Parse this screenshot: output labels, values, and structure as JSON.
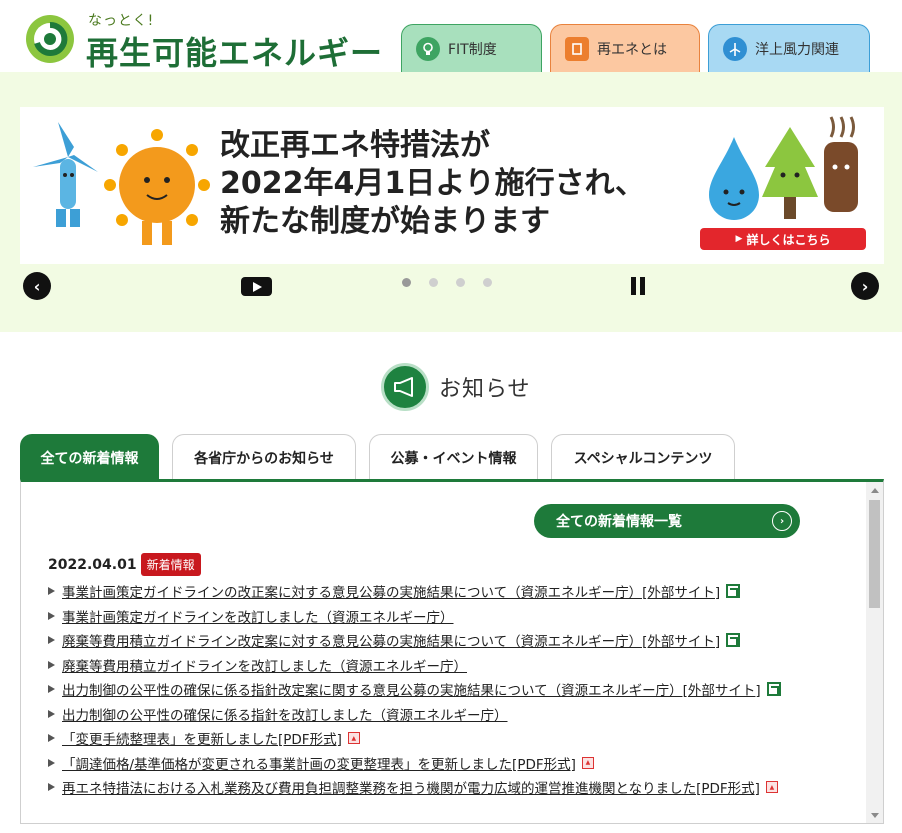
{
  "header": {
    "logo_small": "なっとく!",
    "logo_title": "再生可能エネルギー",
    "nav": [
      {
        "label": "FIT制度",
        "icon": "lightbulb-icon"
      },
      {
        "label": "再エネとは",
        "icon": "document-icon"
      },
      {
        "label": "洋上風力関連",
        "icon": "wind-turbine-icon"
      }
    ]
  },
  "banner": {
    "lines": [
      "改正再エネ特措法が",
      "2022年4月1日より施行され、",
      "新たな制度が始まります"
    ],
    "cta_label": "詳しくはこちら",
    "slide_count": 4,
    "active_slide": 1
  },
  "news": {
    "title": "お知らせ",
    "tabs": [
      "全ての新着情報",
      "各省庁からのお知らせ",
      "公募・イベント情報",
      "スペシャルコンテンツ"
    ],
    "active_tab": 0,
    "all_list_label": "全ての新着情報一覧",
    "date": "2022.04.01",
    "badge": "新着情報",
    "items": [
      {
        "text": "事業計画策定ガイドラインの改正案に対する意見公募の実施結果について（資源エネルギー庁）[外部サイト]",
        "icon": "external-link-icon"
      },
      {
        "text": "事業計画策定ガイドラインを改訂しました（資源エネルギー庁）",
        "icon": ""
      },
      {
        "text": "廃棄等費用積立ガイドライン改定案に対する意見公募の実施結果について（資源エネルギー庁）[外部サイト]",
        "icon": "external-link-icon"
      },
      {
        "text": "廃棄等費用積立ガイドラインを改訂しました（資源エネルギー庁）",
        "icon": ""
      },
      {
        "text": "出力制御の公平性の確保に係る指針改定案に関する意見公募の実施結果について（資源エネルギー庁）[外部サイト]",
        "icon": "external-link-icon"
      },
      {
        "text": "出力制御の公平性の確保に係る指針を改訂しました（資源エネルギー庁）",
        "icon": ""
      },
      {
        "text": "「変更手続整理表」を更新しました[PDF形式]",
        "icon": "pdf-icon"
      },
      {
        "text": "「調達価格/基準価格が変更される事業計画の変更整理表」を更新しました[PDF形式]",
        "icon": "pdf-icon"
      },
      {
        "text": "再エネ特措法における入札業務及び費用負担調整業務を担う機関が電力広域的運営推進機関となりました[PDF形式]",
        "icon": "pdf-icon"
      }
    ]
  },
  "colors": {
    "brand_green": "#1e7a3a",
    "hero_bg": "#f2fbe3",
    "badge_red": "#c8181e",
    "fit_tab": "#a8e0bd",
    "re_tab": "#fcc8a1",
    "wind_tab": "#a8d9f3"
  }
}
